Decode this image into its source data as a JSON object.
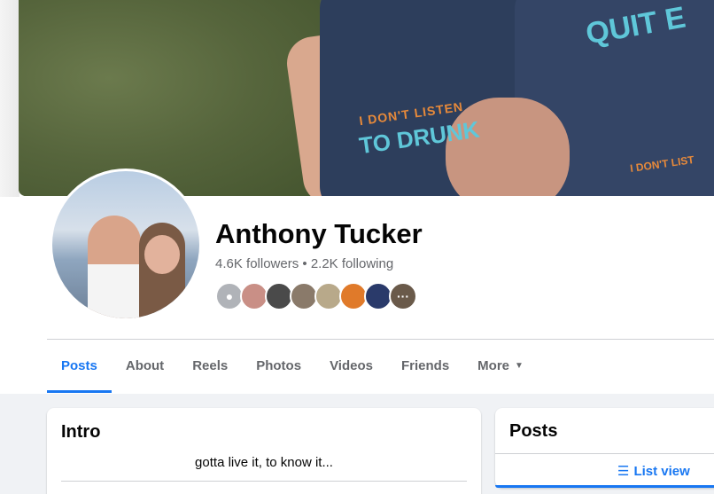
{
  "profile": {
    "name": "Anthony Tucker",
    "followers": "4.6K followers",
    "separator": " • ",
    "following": "2.2K following"
  },
  "cover": {
    "shirt_text_1": "I DON'T LISTEN",
    "shirt_text_2": "TO DRUNK",
    "shirt_text_3": "QUIT E",
    "shirt_text_4": "I DON'T LIST"
  },
  "friends": [
    {
      "name": "default-avatar",
      "color": "#b0b3b8",
      "glyph": "●"
    },
    {
      "name": "friend-2",
      "color": "#c98f86",
      "glyph": ""
    },
    {
      "name": "friend-3",
      "color": "#4a4a4a",
      "glyph": ""
    },
    {
      "name": "friend-4",
      "color": "#8a7a6a",
      "glyph": ""
    },
    {
      "name": "friend-5",
      "color": "#b8a98a",
      "glyph": ""
    },
    {
      "name": "friend-6",
      "color": "#e07a2a",
      "glyph": ""
    },
    {
      "name": "friend-7",
      "color": "#2a3a6a",
      "glyph": ""
    },
    {
      "name": "more",
      "color": "#6a5a4a",
      "glyph": "···"
    }
  ],
  "tabs": [
    {
      "label": "Posts",
      "active": true
    },
    {
      "label": "About"
    },
    {
      "label": "Reels"
    },
    {
      "label": "Photos"
    },
    {
      "label": "Videos"
    },
    {
      "label": "Friends"
    },
    {
      "label": "More"
    }
  ],
  "more_caret": "▼",
  "intro": {
    "title": "Intro",
    "bio": "gotta live it, to know it..."
  },
  "posts_section": {
    "title": "Posts",
    "list_view_icon": "☰",
    "list_view_label": "List view"
  },
  "colors": {
    "accent": "#1877f2",
    "secondary_text": "#65676b",
    "page_bg": "#f0f2f5"
  }
}
